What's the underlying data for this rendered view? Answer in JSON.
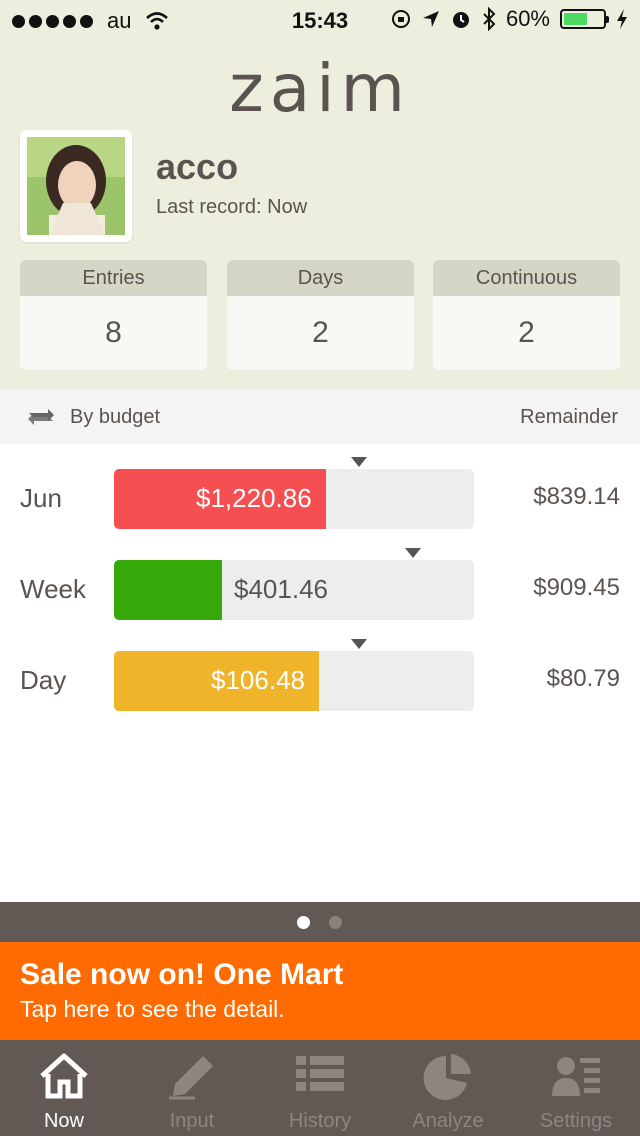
{
  "status_bar": {
    "carrier": "au",
    "time": "15:43",
    "battery": "60%",
    "battery_level": 0.6
  },
  "app": {
    "logo": "zaim"
  },
  "profile": {
    "name": "acco",
    "last_record": "Last record: Now"
  },
  "stats": [
    {
      "label": "Entries",
      "value": "8"
    },
    {
      "label": "Days",
      "value": "2"
    },
    {
      "label": "Continuous",
      "value": "2"
    }
  ],
  "budget": {
    "mode_label": "By budget",
    "remainder_label": "Remainder",
    "rows": [
      {
        "period": "Jun",
        "spent": "$1,220.86",
        "remainder": "$839.14",
        "color": "#f54f52",
        "fill": 0.59,
        "marker": 0.68
      },
      {
        "period": "Week",
        "spent": "$401.46",
        "remainder": "$909.45",
        "color": "#36a80a",
        "fill": 0.3,
        "marker": 0.83
      },
      {
        "period": "Day",
        "spent": "$106.48",
        "remainder": "$80.79",
        "color": "#f0b42a",
        "fill": 0.57,
        "marker": 0.68
      }
    ]
  },
  "pager": {
    "pages": 2,
    "current": 0
  },
  "banner": {
    "title": "Sale now on! One Mart",
    "subtitle": "Tap here to see the detail."
  },
  "tabs": [
    {
      "label": "Now",
      "icon": "home-icon",
      "active": true
    },
    {
      "label": "Input",
      "icon": "pencil-icon",
      "active": false
    },
    {
      "label": "History",
      "icon": "list-icon",
      "active": false
    },
    {
      "label": "Analyze",
      "icon": "pie-chart-icon",
      "active": false
    },
    {
      "label": "Settings",
      "icon": "person-settings-icon",
      "active": false
    }
  ],
  "colors": {
    "header_bg": "#eeeedf",
    "banner": "#ff6b00",
    "tabbar": "#625955"
  }
}
